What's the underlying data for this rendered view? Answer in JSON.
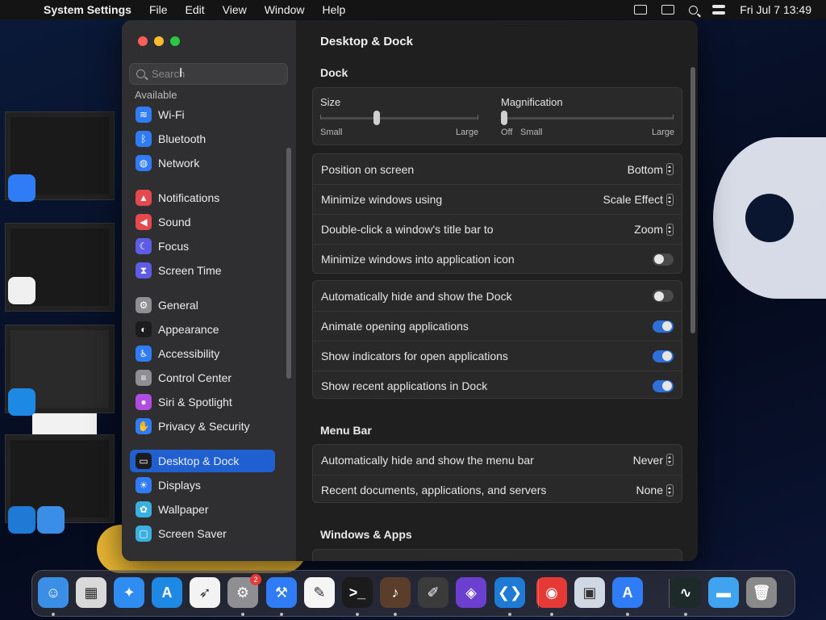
{
  "menubar": {
    "app_name": "System Settings",
    "items": [
      "File",
      "Edit",
      "View",
      "Window",
      "Help"
    ],
    "clock": "Fri Jul 7  13:49"
  },
  "sidebar": {
    "search_placeholder": "Search",
    "partial_item": "Available",
    "items": [
      {
        "label": "Wi-Fi",
        "icon": "wifi-icon",
        "color": "#2f7cf6"
      },
      {
        "label": "Bluetooth",
        "icon": "bluetooth-icon",
        "color": "#2f7cf6"
      },
      {
        "label": "Network",
        "icon": "globe-icon",
        "color": "#2f7cf6"
      },
      {
        "label": "Notifications",
        "icon": "bell-icon",
        "color": "#e5484d"
      },
      {
        "label": "Sound",
        "icon": "speaker-icon",
        "color": "#e5484d"
      },
      {
        "label": "Focus",
        "icon": "moon-icon",
        "color": "#5e5ce6"
      },
      {
        "label": "Screen Time",
        "icon": "hourglass-icon",
        "color": "#5e5ce6"
      },
      {
        "label": "General",
        "icon": "gear-icon",
        "color": "#8e8e93"
      },
      {
        "label": "Appearance",
        "icon": "appearance-icon",
        "color": "#1c1c1e"
      },
      {
        "label": "Accessibility",
        "icon": "accessibility-icon",
        "color": "#2f7cf6"
      },
      {
        "label": "Control Center",
        "icon": "toggles-icon",
        "color": "#8e8e93"
      },
      {
        "label": "Siri & Spotlight",
        "icon": "siri-icon",
        "color": "#b04ce0"
      },
      {
        "label": "Privacy & Security",
        "icon": "hand-icon",
        "color": "#2f7cf6"
      },
      {
        "label": "Desktop & Dock",
        "icon": "dock-icon",
        "color": "#1c1c1e"
      },
      {
        "label": "Displays",
        "icon": "sun-icon",
        "color": "#2f7cf6"
      },
      {
        "label": "Wallpaper",
        "icon": "flower-icon",
        "color": "#3ab0e0"
      },
      {
        "label": "Screen Saver",
        "icon": "screensaver-icon",
        "color": "#3ab0e0"
      }
    ],
    "selected": "Desktop & Dock"
  },
  "main": {
    "title": "Desktop & Dock",
    "dock_section": "Dock",
    "size": {
      "label": "Size",
      "min": "Small",
      "max": "Large",
      "value": 0.35
    },
    "magnification": {
      "label": "Magnification",
      "off": "Off",
      "min": "Small",
      "max": "Large",
      "value": 0.0
    },
    "settings": [
      {
        "label": "Position on screen",
        "value": "Bottom"
      },
      {
        "label": "Minimize windows using",
        "value": "Scale Effect"
      },
      {
        "label": "Double-click a window's title bar to",
        "value": "Zoom"
      },
      {
        "label": "Minimize windows into application icon",
        "toggle": false
      }
    ],
    "dock_toggles": [
      {
        "label": "Automatically hide and show the Dock",
        "toggle": false
      },
      {
        "label": "Animate opening applications",
        "toggle": true
      },
      {
        "label": "Show indicators for open applications",
        "toggle": true
      },
      {
        "label": "Show recent applications in Dock",
        "toggle": true
      }
    ],
    "menubar_section": "Menu Bar",
    "menubar_settings": [
      {
        "label": "Automatically hide and show the menu bar",
        "value": "Never"
      },
      {
        "label": "Recent documents, applications, and servers",
        "value": "None"
      }
    ],
    "windows_section": "Windows & Apps"
  },
  "dock": {
    "apps": [
      {
        "name": "finder-icon",
        "color": "#3a8ee6",
        "glyph": "☺"
      },
      {
        "name": "launchpad-icon",
        "color": "#d9d9d9",
        "glyph": "▦"
      },
      {
        "name": "safari-icon",
        "color": "#2f8cf0",
        "glyph": "✦"
      },
      {
        "name": "app-store-icon",
        "color": "#1e88e5",
        "glyph": "A"
      },
      {
        "name": "swift-icon",
        "color": "#f3f3f3",
        "glyph": "➶"
      },
      {
        "name": "system-settings-icon",
        "color": "#8e8e93",
        "glyph": "⚙",
        "badge": "2"
      },
      {
        "name": "xcode-icon",
        "color": "#2f7cf6",
        "glyph": "⚒"
      },
      {
        "name": "textedit-icon",
        "color": "#f5f5f5",
        "glyph": "✎"
      },
      {
        "name": "terminal-icon",
        "color": "#1b1b1b",
        "glyph": ">_"
      },
      {
        "name": "instruments-icon",
        "color": "#5a3e2b",
        "glyph": "♪"
      },
      {
        "name": "sketch-icon",
        "color": "#3b3b3b",
        "glyph": "✐"
      },
      {
        "name": "visual-studio-icon",
        "color": "#6b3fd0",
        "glyph": "◈"
      },
      {
        "name": "vscode-icon",
        "color": "#1f7ad6",
        "glyph": "❮❯"
      },
      {
        "name": "chrome-icon",
        "color": "#e53935",
        "glyph": "◉"
      },
      {
        "name": "preview-icon",
        "color": "#cfd8e3",
        "glyph": "▣"
      },
      {
        "name": "simulator-icon",
        "color": "#2f7cf6",
        "glyph": "A"
      },
      {
        "name": "activity-monitor-icon",
        "color": "#1e2a2a",
        "glyph": "∿"
      },
      {
        "name": "downloads-folder-icon",
        "color": "#3fa3f0",
        "glyph": "▬"
      },
      {
        "name": "trash-icon",
        "color": "#8a8a8a",
        "glyph": "🗑"
      }
    ]
  }
}
